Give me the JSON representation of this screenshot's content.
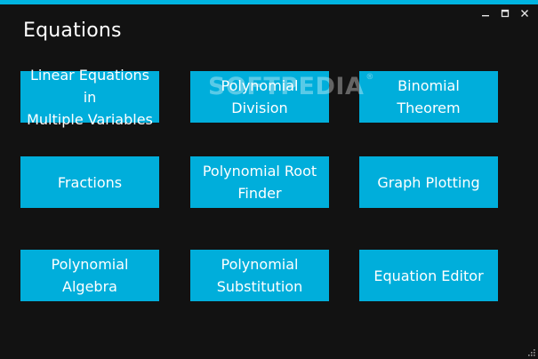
{
  "window": {
    "title": "Equations",
    "controls": {
      "minimize": "minimize-icon",
      "maximize": "maximize-icon",
      "close": "close-icon"
    }
  },
  "tiles": [
    {
      "label": "Linear Equations in\nMultiple Variables"
    },
    {
      "label": "Polynomial\nDivision"
    },
    {
      "label": "Binomial\nTheorem"
    },
    {
      "label": "Fractions"
    },
    {
      "label": "Polynomial Root\nFinder"
    },
    {
      "label": "Graph Plotting"
    },
    {
      "label": "Polynomial\nAlgebra"
    },
    {
      "label": "Polynomial\nSubstitution"
    },
    {
      "label": "Equation Editor"
    }
  ],
  "watermark": {
    "text": "SOFTPEDIA",
    "mark": "®"
  },
  "colors": {
    "background": "#121212",
    "accent": "#00b4e1",
    "tile": "#00aedb",
    "text": "#ffffff"
  }
}
